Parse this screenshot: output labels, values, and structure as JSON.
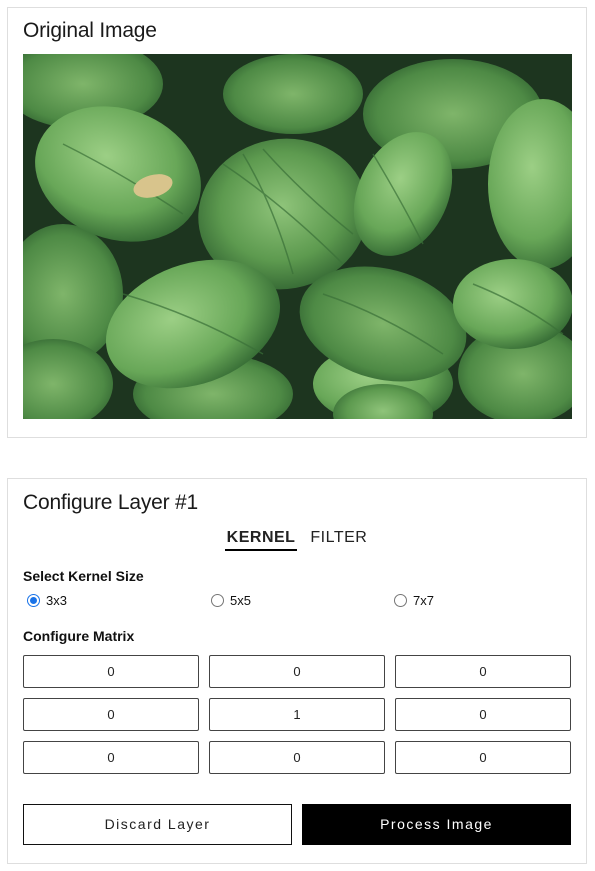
{
  "original": {
    "title": "Original Image"
  },
  "config": {
    "title": "Configure Layer #1",
    "tabs": [
      {
        "label": "KERNEL",
        "active": true
      },
      {
        "label": "FILTER",
        "active": false
      }
    ],
    "kernel_size_label": "Select Kernel Size",
    "kernel_sizes": [
      {
        "label": "3x3",
        "checked": true
      },
      {
        "label": "5x5",
        "checked": false
      },
      {
        "label": "7x7",
        "checked": false
      }
    ],
    "matrix_label": "Configure Matrix",
    "matrix": [
      [
        "0",
        "0",
        "0"
      ],
      [
        "0",
        "1",
        "0"
      ],
      [
        "0",
        "0",
        "0"
      ]
    ],
    "discard_label": "Discard Layer",
    "process_label": "Process Image"
  },
  "colors": {
    "accent_radio": "#1a73e8",
    "primary_button": "#000000",
    "card_border": "#dedede"
  }
}
